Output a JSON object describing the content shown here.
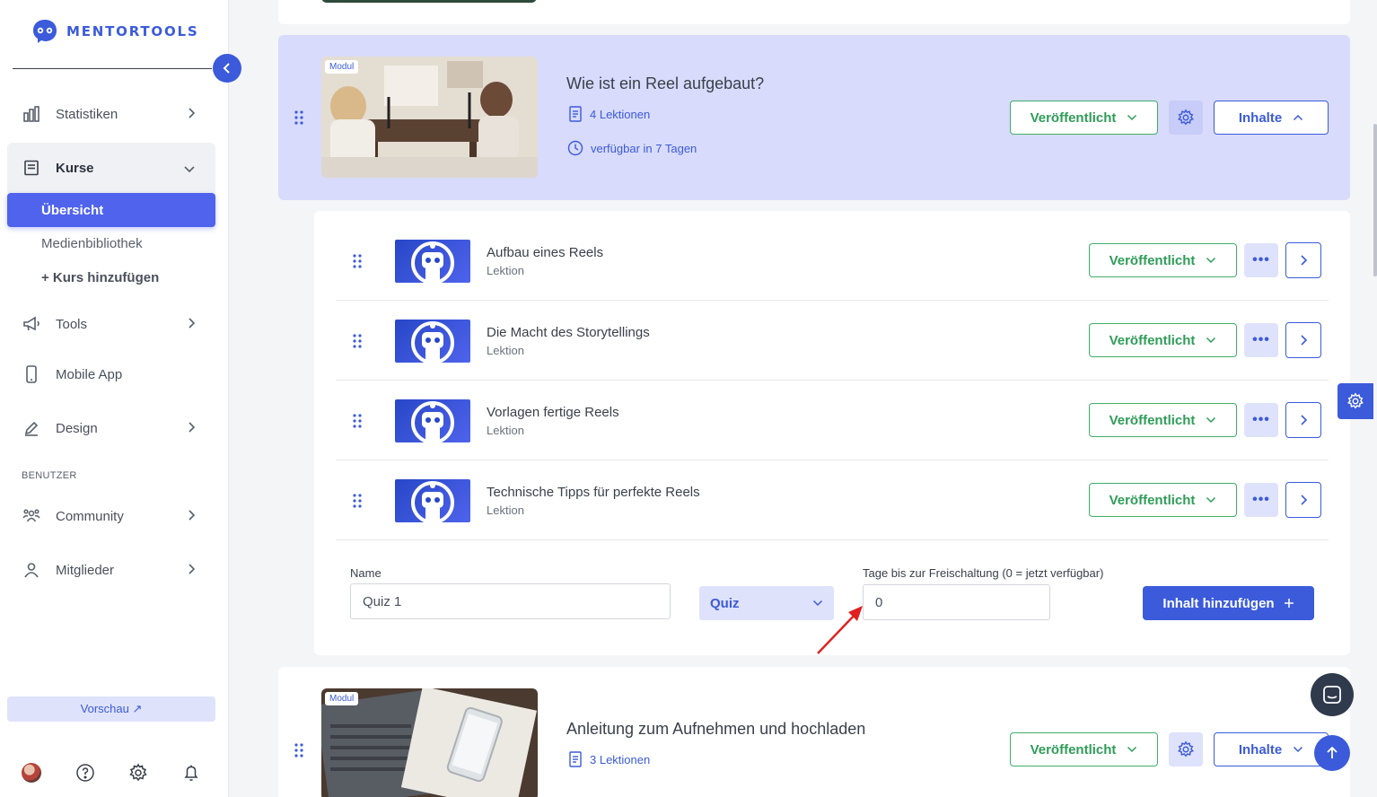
{
  "brand": {
    "name": "MENTORTOOLS",
    "accent": "#3b5bdb",
    "success": "#2f9d58"
  },
  "sidebar": {
    "items": [
      {
        "label": "Statistiken",
        "icon": "bar-chart-icon"
      },
      {
        "label": "Kurse",
        "icon": "book-icon"
      },
      {
        "label": "Tools",
        "icon": "megaphone-icon"
      },
      {
        "label": "Mobile App",
        "icon": "phone-icon"
      },
      {
        "label": "Design",
        "icon": "pencil-icon"
      }
    ],
    "sub_items": {
      "active": "Übersicht",
      "media": "Medienbibliothek",
      "add": "+ Kurs hinzufügen"
    },
    "section_label": "BENUTZER",
    "user_items": [
      {
        "label": "Community",
        "icon": "users-icon"
      },
      {
        "label": "Mitglieder",
        "icon": "user-icon"
      }
    ],
    "preview_label": "Vorschau ↗"
  },
  "module_active": {
    "badge": "Modul",
    "title": "Wie ist ein Reel aufgebaut?",
    "lessons_count": "4 Lektionen",
    "availability": "verfügbar in 7 Tagen",
    "status": "Veröffentlicht",
    "content_button": "Inhalte"
  },
  "lessons": [
    {
      "title": "Aufbau eines Reels",
      "type": "Lektion",
      "status": "Veröffentlicht"
    },
    {
      "title": "Die Macht des Storytellings",
      "type": "Lektion",
      "status": "Veröffentlicht"
    },
    {
      "title": "Vorlagen fertige Reels",
      "type": "Lektion",
      "status": "Veröffentlicht"
    },
    {
      "title": "Technische Tipps für perfekte Reels",
      "type": "Lektion",
      "status": "Veröffentlicht"
    }
  ],
  "add_form": {
    "name_label": "Name",
    "name_value": "Quiz 1",
    "type_value": "Quiz",
    "days_label": "Tage bis zur Freischaltung (0 = jetzt verfügbar)",
    "days_value": "0",
    "add_button": "Inhalt hinzufügen"
  },
  "module_next": {
    "badge": "Modul",
    "title": "Anleitung zum Aufnehmen und hochladen",
    "lessons_count": "3 Lektionen",
    "status": "Veröffentlicht",
    "content_button": "Inhalte"
  }
}
